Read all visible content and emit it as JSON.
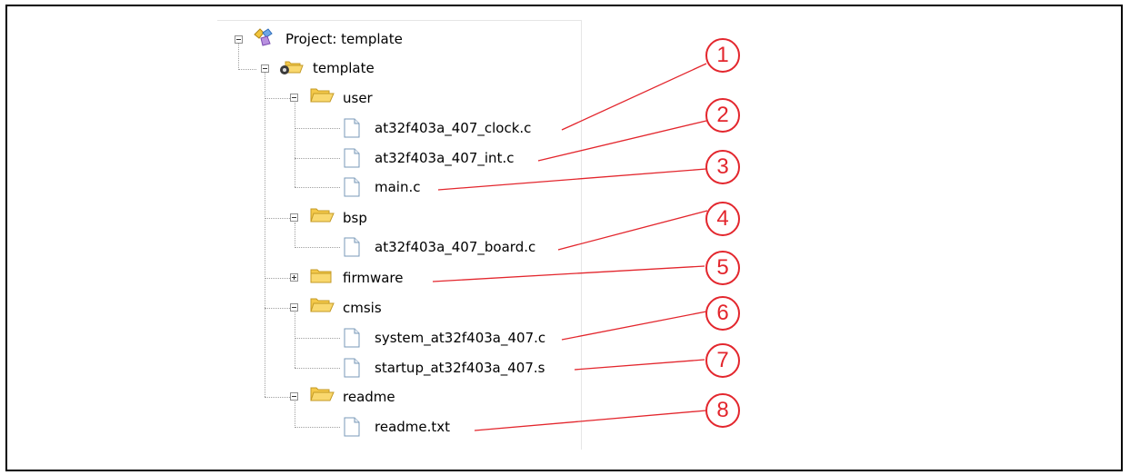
{
  "tree": {
    "project_label": "Project: template",
    "root_folder": "template",
    "groups": [
      {
        "name": "user",
        "files": [
          "at32f403a_407_clock.c",
          "at32f403a_407_int.c",
          "main.c"
        ]
      },
      {
        "name": "bsp",
        "files": [
          "at32f403a_407_board.c"
        ]
      },
      {
        "name": "firmware",
        "files": []
      },
      {
        "name": "cmsis",
        "files": [
          "system_at32f403a_407.c",
          "startup_at32f403a_407.s"
        ]
      },
      {
        "name": "readme",
        "files": [
          "readme.txt"
        ]
      }
    ]
  },
  "callouts": [
    "1",
    "2",
    "3",
    "4",
    "5",
    "6",
    "7",
    "8"
  ],
  "colors": {
    "callout": "#e3262d",
    "folder": "#f5c94a",
    "file": "#ffffff",
    "file_border": "#7a9ab8"
  }
}
